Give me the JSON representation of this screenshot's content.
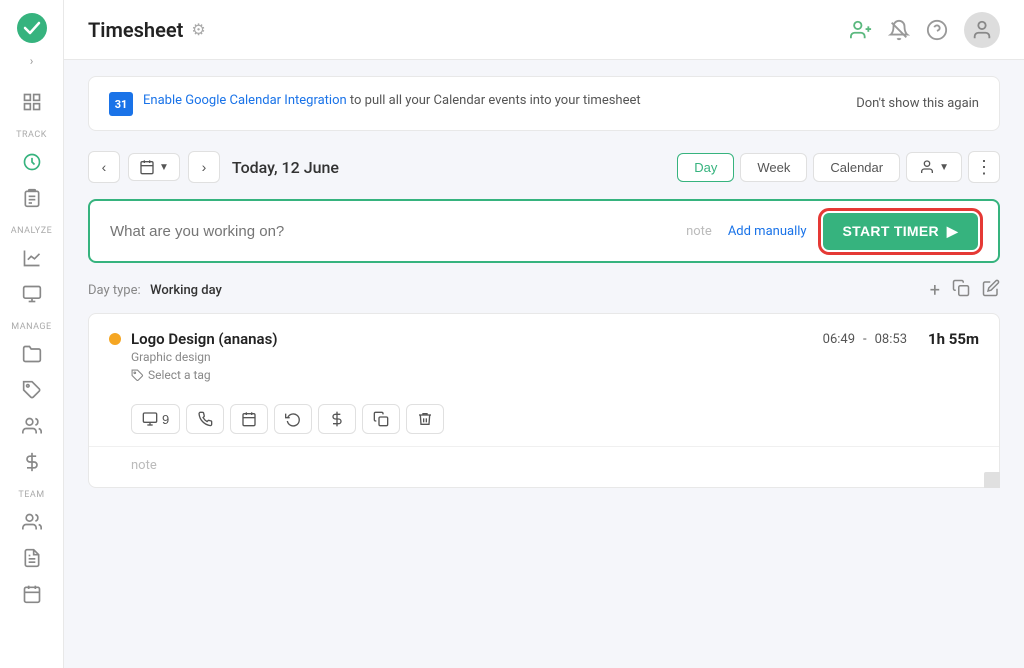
{
  "app": {
    "logo_text": "✓",
    "arrow_icon": "›"
  },
  "sidebar": {
    "sections": [
      {
        "label": "",
        "items": [
          {
            "id": "grid",
            "icon": "grid",
            "active": false
          },
          {
            "id": "arrow",
            "icon": "arrow-right",
            "active": false
          }
        ]
      },
      {
        "label": "TRACK",
        "items": [
          {
            "id": "clock",
            "icon": "clock",
            "active": true
          },
          {
            "id": "clipboard",
            "icon": "clipboard",
            "active": false
          }
        ]
      },
      {
        "label": "ANALYZE",
        "items": [
          {
            "id": "chart",
            "icon": "pie-chart",
            "active": false
          },
          {
            "id": "monitor",
            "icon": "monitor",
            "active": false
          }
        ]
      },
      {
        "label": "MANAGE",
        "items": [
          {
            "id": "folder",
            "icon": "folder",
            "active": false
          },
          {
            "id": "tag",
            "icon": "tag",
            "active": false
          },
          {
            "id": "users",
            "icon": "users",
            "active": false
          },
          {
            "id": "dollar",
            "icon": "dollar",
            "active": false
          }
        ]
      },
      {
        "label": "TEAM",
        "items": [
          {
            "id": "team",
            "icon": "team",
            "active": false
          },
          {
            "id": "report",
            "icon": "report",
            "active": false
          },
          {
            "id": "calendar-team",
            "icon": "calendar",
            "active": false
          }
        ]
      }
    ]
  },
  "header": {
    "title": "Timesheet",
    "gear_label": "⚙",
    "icons": {
      "add_user": "add-user",
      "notification": "notification",
      "help": "help",
      "avatar": "avatar"
    }
  },
  "banner": {
    "cal_number": "31",
    "text_before_link": "",
    "link_text": "Enable Google Calendar Integration",
    "text_after": " to pull all your Calendar events into your timesheet",
    "dismiss": "Don't show this again"
  },
  "date_nav": {
    "date_display": "Today, 12 June",
    "prev_icon": "‹",
    "next_icon": "›",
    "cal_icon": "📅"
  },
  "view_tabs": {
    "tabs": [
      {
        "id": "day",
        "label": "Day",
        "active": true
      },
      {
        "id": "week",
        "label": "Week",
        "active": false
      },
      {
        "id": "calendar",
        "label": "Calendar",
        "active": false
      }
    ],
    "user_tab_icon": "👤",
    "more_icon": "⋮"
  },
  "timer": {
    "placeholder": "What are you working on?",
    "note_label": "note",
    "add_manually": "Add manually",
    "start_button": "START TIMER",
    "play_icon": "▶"
  },
  "day_section": {
    "label": "Day type:",
    "value": "Working day",
    "add_icon": "+",
    "copy_icon": "⧉",
    "edit_icon": "✎"
  },
  "entries": [
    {
      "id": 1,
      "title": "Logo Design (ananas)",
      "subtitle": "Graphic design",
      "tag_placeholder": "Select a tag",
      "tag_icon": "🏷",
      "dot_color": "#f5a623",
      "start_time": "06:49",
      "dash": "-",
      "end_time": "08:53",
      "duration": "1h 55m",
      "actions": [
        {
          "id": "screen",
          "icon": "monitor",
          "label": "9"
        },
        {
          "id": "phone",
          "icon": "phone"
        },
        {
          "id": "calendar",
          "icon": "calendar"
        },
        {
          "id": "history",
          "icon": "history"
        },
        {
          "id": "billing",
          "icon": "dollar"
        },
        {
          "id": "copy",
          "icon": "copy"
        },
        {
          "id": "delete",
          "icon": "trash"
        }
      ],
      "note_placeholder": "note"
    }
  ]
}
